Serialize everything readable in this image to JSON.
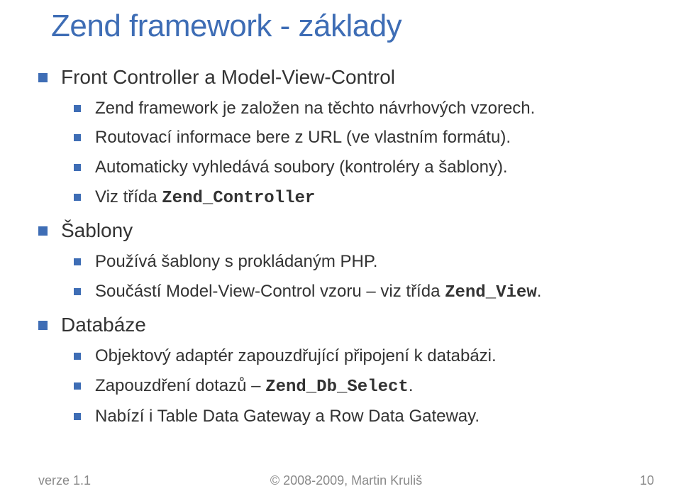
{
  "title": "Zend framework - základy",
  "sections": [
    {
      "heading": "Front Controller a Model-View-Control",
      "items": [
        {
          "text": "Zend framework je založen na těchto návrhových vzorech."
        },
        {
          "text": "Routovací informace bere z URL (ve vlastním formátu)."
        },
        {
          "text": "Automaticky vyhledává soubory (kontroléry a šablony)."
        },
        {
          "prefix": "Viz třída ",
          "code": "Zend_Controller"
        }
      ]
    },
    {
      "heading": "Šablony",
      "items": [
        {
          "text": "Používá šablony s prokládaným PHP."
        },
        {
          "prefix": "Součástí Model-View-Control vzoru – viz třída ",
          "code": "Zend_View",
          "suffix": "."
        }
      ]
    },
    {
      "heading": "Databáze",
      "items": [
        {
          "text": "Objektový adaptér zapouzdřující připojení k databázi."
        },
        {
          "prefix": "Zapouzdření dotazů – ",
          "code": "Zend_Db_Select",
          "suffix": "."
        },
        {
          "text": "Nabízí i Table Data Gateway a Row Data Gateway."
        }
      ]
    }
  ],
  "footer": {
    "left": "verze 1.1",
    "center": "© 2008-2009, Martin Kruliš",
    "right": "10"
  }
}
